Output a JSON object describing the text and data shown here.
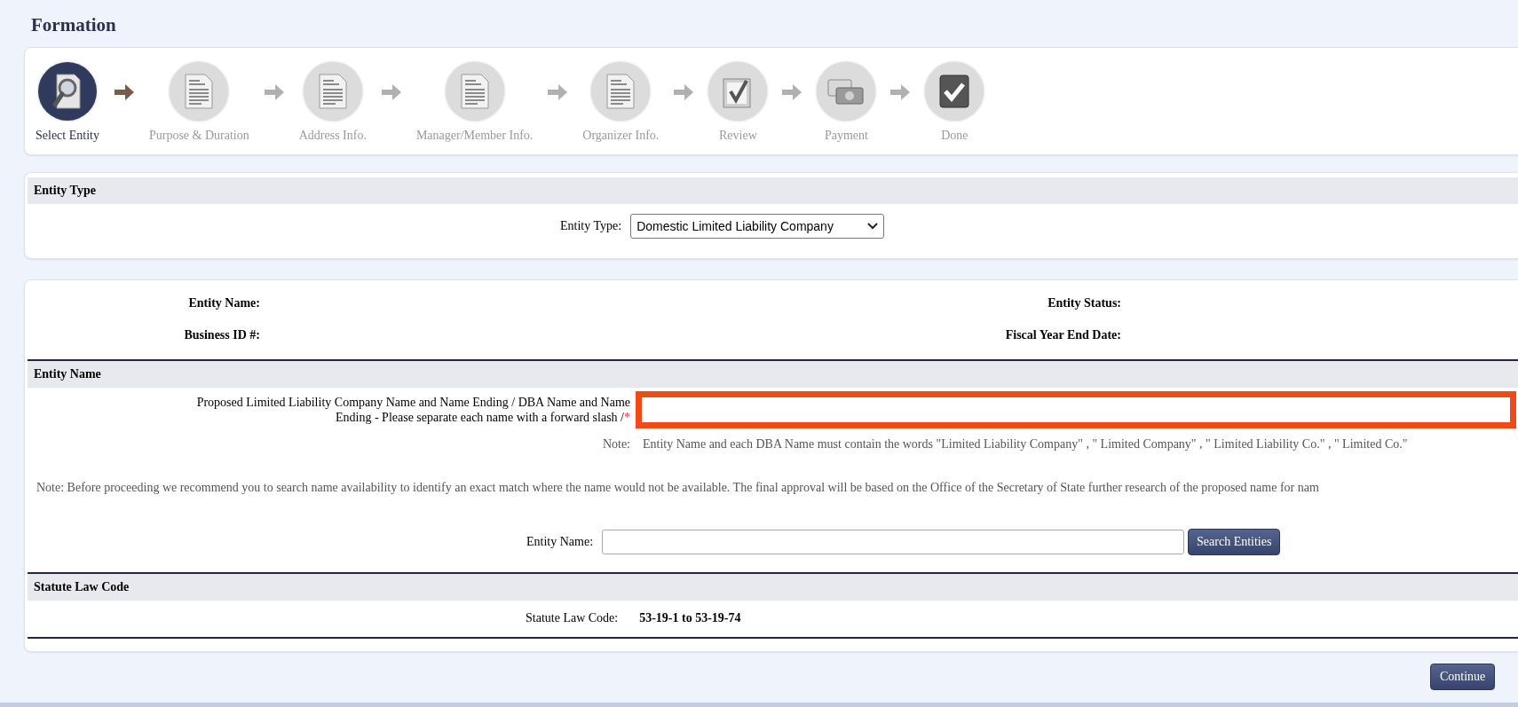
{
  "page_title": "Formation",
  "steps": [
    {
      "label": "Select Entity",
      "kind": "select",
      "selected": true
    },
    {
      "label": "Purpose & Duration",
      "kind": "document",
      "selected": false
    },
    {
      "label": "Address Info.",
      "kind": "document",
      "selected": false
    },
    {
      "label": "Manager/Member Info.",
      "kind": "document",
      "selected": false
    },
    {
      "label": "Organizer Info.",
      "kind": "document",
      "selected": false
    },
    {
      "label": "Review",
      "kind": "review",
      "selected": false
    },
    {
      "label": "Payment",
      "kind": "payment",
      "selected": false
    },
    {
      "label": "Done",
      "kind": "done",
      "selected": false
    }
  ],
  "entity_type_section": {
    "heading": "Entity Type",
    "label": "Entity Type:",
    "value": "Domestic Limited Liability Company"
  },
  "entity_info": [
    {
      "label": "Entity Name:"
    },
    {
      "label": "Entity Status:"
    },
    {
      "label": "Business ID #:"
    },
    {
      "label": "Fiscal Year End Date:"
    }
  ],
  "entity_name_section": {
    "heading": "Entity Name",
    "field_label": "Proposed Limited Liability Company Name and Name Ending / DBA Name and Name Ending - Please separate each name with a forward slash /",
    "required_mark": "*",
    "invalid": true,
    "note_label": "Note:",
    "note": "Entity Name and each DBA Name must contain the words \"Limited Liability Company\" , \" Limited Company\" , \" Limited Liability Co.\" , \" Limited Co.\"",
    "availability_note": "Note: Before proceeding we recommend you to search name availability to identify an exact match where the name would not be available. The final approval will be based on the Office of the Secretary of State further research of the proposed name for nam",
    "search_label": "Entity Name:",
    "search_button": "Search Entities"
  },
  "statute_section": {
    "heading": "Statute Law Code",
    "label": "Statute Law Code:",
    "value": "53-19-1 to 53-19-74"
  },
  "continue_button": "Continue"
}
